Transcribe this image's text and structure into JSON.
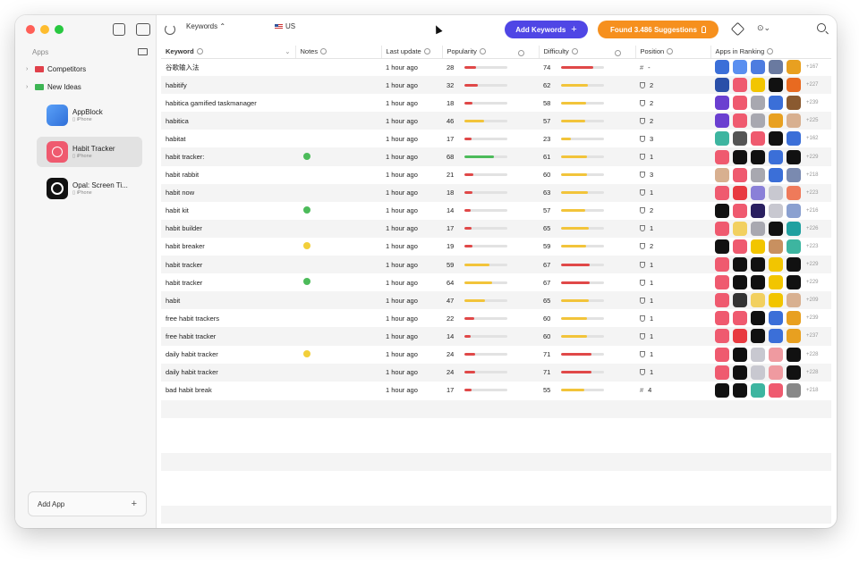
{
  "sidebar": {
    "title": "Apps",
    "groups": [
      {
        "label": "Competitors",
        "color": "#e0404a"
      },
      {
        "label": "New Ideas",
        "color": "#3db554"
      }
    ],
    "apps": [
      {
        "name": "AppBlock",
        "platform": "iPhone",
        "color": "#3f8cf0"
      },
      {
        "name": "Habit Tracker",
        "platform": "iPhone",
        "color": "#ef5a6f"
      },
      {
        "name": "Opal: Screen Ti...",
        "platform": "iPhone",
        "color": "#111111"
      }
    ],
    "add_app_label": "Add App",
    "add_app_plus": "+"
  },
  "toolbar": {
    "keyword_selector": "Keywords ⌃",
    "country": "US",
    "add_keywords_label": "Add Keywords",
    "add_keywords_plus": "+",
    "found_label": "Found 3.486 Suggestions",
    "more_label": "⊙⌄"
  },
  "table": {
    "columns": [
      "Keyword",
      "Notes",
      "Last update",
      "Popularity",
      "Difficulty",
      "Position",
      "Apps in Ranking"
    ],
    "rows": [
      {
        "keyword": "谷歌输入法",
        "note": "",
        "updated": "1 hour ago",
        "popularity": 28,
        "difficulty": 74,
        "pos_type": "hash",
        "position": "-",
        "apps": [
          "#3b6fd8",
          "#5a8ff0",
          "#4d7ce0",
          "#6a7aa0",
          "#e8a020"
        ],
        "more": "+167"
      },
      {
        "keyword": "habitify",
        "note": "",
        "updated": "1 hour ago",
        "popularity": 32,
        "difficulty": 62,
        "pos_type": "trophy",
        "position": "2",
        "apps": [
          "#2a4fa8",
          "#ef5a6f",
          "#f2c500",
          "#111111",
          "#e86a20"
        ],
        "more": "+227"
      },
      {
        "keyword": "habitica gamified taskmanager",
        "note": "",
        "updated": "1 hour ago",
        "popularity": 18,
        "difficulty": 58,
        "pos_type": "trophy",
        "position": "2",
        "apps": [
          "#6a3fd0",
          "#ef5a6f",
          "#a8a8b0",
          "#3b6fd8",
          "#8a5a30"
        ],
        "more": "+239"
      },
      {
        "keyword": "habitica",
        "note": "",
        "updated": "1 hour ago",
        "popularity": 46,
        "difficulty": 57,
        "pos_type": "trophy",
        "position": "2",
        "apps": [
          "#6a3fd0",
          "#ef5a6f",
          "#a8a8b0",
          "#e8a020",
          "#d8b090"
        ],
        "more": "+225"
      },
      {
        "keyword": "habitat",
        "note": "",
        "updated": "1 hour ago",
        "popularity": 17,
        "difficulty": 23,
        "pos_type": "trophy",
        "position": "3",
        "apps": [
          "#3db5a0",
          "#555555",
          "#ef5a6f",
          "#111111",
          "#3b6fd8"
        ],
        "more": "+162"
      },
      {
        "keyword": "habit tracker:",
        "note": "green",
        "updated": "1 hour ago",
        "popularity": 68,
        "difficulty": 61,
        "pos_type": "trophy",
        "position": "1",
        "apps": [
          "#ef5a6f",
          "#111111",
          "#111111",
          "#3b6fd8",
          "#111111"
        ],
        "more": "+229"
      },
      {
        "keyword": "habit rabbit",
        "note": "",
        "updated": "1 hour ago",
        "popularity": 21,
        "difficulty": 60,
        "pos_type": "trophy",
        "position": "3",
        "apps": [
          "#d8b090",
          "#ef5a6f",
          "#a8a8b0",
          "#3b6fd8",
          "#7a8ab0"
        ],
        "more": "+218"
      },
      {
        "keyword": "habit now",
        "note": "",
        "updated": "1 hour ago",
        "popularity": 18,
        "difficulty": 63,
        "pos_type": "trophy",
        "position": "1",
        "apps": [
          "#ef5a6f",
          "#e83a40",
          "#8a80d8",
          "#c8c8d0",
          "#ef7a5a"
        ],
        "more": "+223"
      },
      {
        "keyword": "habit kit",
        "note": "green",
        "updated": "1 hour ago",
        "popularity": 14,
        "difficulty": 57,
        "pos_type": "trophy",
        "position": "2",
        "apps": [
          "#111111",
          "#ef5a6f",
          "#2a2060",
          "#c8c8d0",
          "#8aa0d0"
        ],
        "more": "+216"
      },
      {
        "keyword": "habit builder",
        "note": "",
        "updated": "1 hour ago",
        "popularity": 17,
        "difficulty": 65,
        "pos_type": "trophy",
        "position": "1",
        "apps": [
          "#ef5a6f",
          "#f2d060",
          "#a8a8b0",
          "#111111",
          "#20a0a0"
        ],
        "more": "+226"
      },
      {
        "keyword": "habit breaker",
        "note": "yellow",
        "updated": "1 hour ago",
        "popularity": 19,
        "difficulty": 59,
        "pos_type": "trophy",
        "position": "2",
        "apps": [
          "#111111",
          "#ef5a6f",
          "#f2c500",
          "#c89060",
          "#3db5a0"
        ],
        "more": "+223"
      },
      {
        "keyword": "habit  tracker",
        "note": "",
        "updated": "1 hour ago",
        "popularity": 59,
        "difficulty": 67,
        "pos_type": "trophy",
        "position": "1",
        "apps": [
          "#ef5a6f",
          "#111111",
          "#111111",
          "#f2c500",
          "#111111"
        ],
        "more": "+229"
      },
      {
        "keyword": "habit   tracker",
        "note": "green",
        "updated": "1 hour ago",
        "popularity": 64,
        "difficulty": 67,
        "pos_type": "trophy",
        "position": "1",
        "apps": [
          "#ef5a6f",
          "#111111",
          "#111111",
          "#f2c500",
          "#111111"
        ],
        "more": "+229"
      },
      {
        "keyword": "habit",
        "note": "",
        "updated": "1 hour ago",
        "popularity": 47,
        "difficulty": 65,
        "pos_type": "trophy",
        "position": "1",
        "apps": [
          "#ef5a6f",
          "#333333",
          "#f2d060",
          "#f2c500",
          "#d8b090"
        ],
        "more": "+209"
      },
      {
        "keyword": "free habit trackers",
        "note": "",
        "updated": "1 hour ago",
        "popularity": 22,
        "difficulty": 60,
        "pos_type": "trophy",
        "position": "1",
        "apps": [
          "#ef5a6f",
          "#ef5a6f",
          "#111111",
          "#3b6fd8",
          "#e8a020"
        ],
        "more": "+239"
      },
      {
        "keyword": "free habit tracker",
        "note": "",
        "updated": "1 hour ago",
        "popularity": 14,
        "difficulty": 60,
        "pos_type": "trophy",
        "position": "1",
        "apps": [
          "#ef5a6f",
          "#e83a40",
          "#111111",
          "#3b6fd8",
          "#e8a020"
        ],
        "more": "+237"
      },
      {
        "keyword": "daily habit tracker",
        "note": "yellow",
        "updated": "1 hour ago",
        "popularity": 24,
        "difficulty": 71,
        "pos_type": "trophy",
        "position": "1",
        "apps": [
          "#ef5a6f",
          "#111111",
          "#c8c8d0",
          "#ef9aa0",
          "#111111"
        ],
        "more": "+228"
      },
      {
        "keyword": "daily habit  tracker",
        "note": "",
        "updated": "1 hour ago",
        "popularity": 24,
        "difficulty": 71,
        "pos_type": "trophy",
        "position": "1",
        "apps": [
          "#ef5a6f",
          "#111111",
          "#c8c8d0",
          "#ef9aa0",
          "#111111"
        ],
        "more": "+228"
      },
      {
        "keyword": "bad habit break",
        "note": "",
        "updated": "1 hour ago",
        "popularity": 17,
        "difficulty": 55,
        "pos_type": "hash",
        "position": "4",
        "apps": [
          "#111111",
          "#111111",
          "#3db5a0",
          "#ef5a6f",
          "#888888"
        ],
        "more": "+218"
      }
    ]
  },
  "colors": {
    "accent": "#4f46e5",
    "orange": "#f6901e",
    "bar_low": "#e04848",
    "bar_mid": "#f2c43a",
    "bar_high": "#4cbb5a",
    "note_green": "#4cbb5a",
    "note_yellow": "#f2cf3a"
  }
}
